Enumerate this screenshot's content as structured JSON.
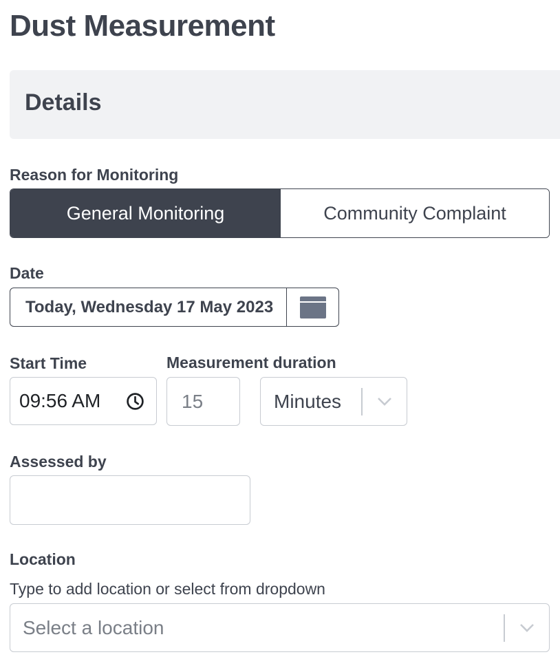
{
  "page": {
    "title": "Dust Measurement"
  },
  "details": {
    "title": "Details"
  },
  "reason": {
    "label": "Reason for Monitoring",
    "options": [
      "General Monitoring",
      "Community Complaint"
    ],
    "selected": "General Monitoring"
  },
  "date": {
    "label": "Date",
    "value": "Today, Wednesday 17 May 2023",
    "icon": "calendar-icon"
  },
  "start_time": {
    "label": "Start Time",
    "value": "09:56 AM",
    "icon": "clock-icon"
  },
  "duration": {
    "label": "Measurement duration",
    "value": "15",
    "unit": "Minutes"
  },
  "assessed_by": {
    "label": "Assessed by",
    "value": ""
  },
  "location": {
    "label": "Location",
    "helper": "Type to add location or select from dropdown",
    "placeholder": "Select a location"
  },
  "colors": {
    "primary": "#3e434e",
    "panel": "#f1f2f4",
    "border": "#c7cbd1",
    "icon": "#6b7486"
  }
}
